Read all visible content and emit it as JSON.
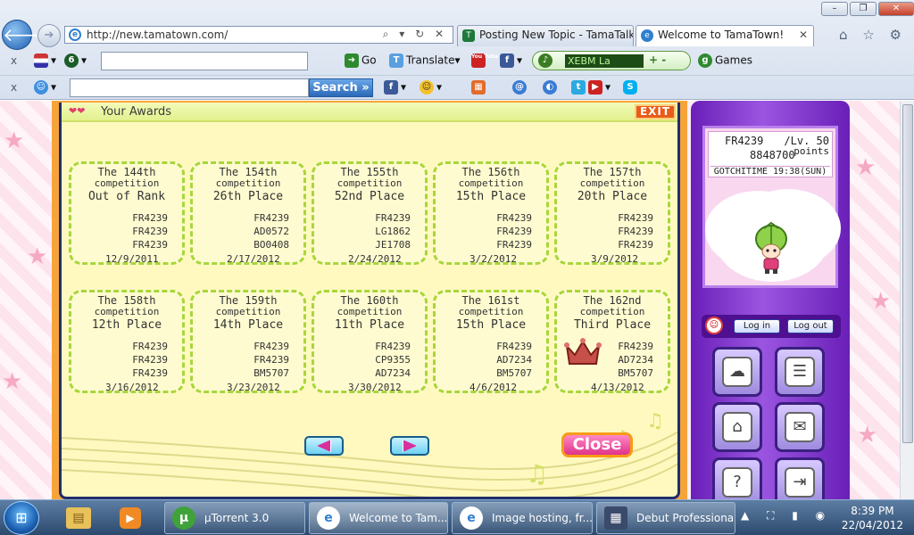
{
  "browser": {
    "window_buttons": {
      "minimize": "–",
      "maximize": "❐",
      "close": "✕"
    },
    "back_glyph": "🡐",
    "forward_glyph": "➔",
    "url": "http://new.tamatown.com/",
    "addr_tools": "⌕ ▾ ↻ ✕",
    "tabs": [
      {
        "label": "Posting New Topic - TamaTalk",
        "active": false
      },
      {
        "label": "Welcome to TamaTown!",
        "active": true
      }
    ],
    "tab_close": "✕",
    "right_tools": "⌂ ☆ ⚙",
    "toolbar1": {
      "close": "x",
      "go": "Go",
      "translate": "Translate",
      "radio_station": "XEBM La",
      "radio_controls": "+ -",
      "games": "Games",
      "tube_badge": "You Tube",
      "fb_badge": "f"
    },
    "toolbar2": {
      "close": "x",
      "search_button": "Search »",
      "fb_badge": "f",
      "skype_badge": "S"
    }
  },
  "awards": {
    "title": "Your Awards",
    "exit": "EXIT",
    "close": "Close",
    "cards": [
      {
        "comp1": "The 144th",
        "comp2": "competition",
        "place": "Out of Rank",
        "names": [
          "FR4239",
          "FR4239",
          "FR4239"
        ],
        "date": "12/9/2011",
        "crown": false
      },
      {
        "comp1": "The 154th",
        "comp2": "competition",
        "place": "26th Place",
        "names": [
          "FR4239",
          "AD0572",
          "BO0408"
        ],
        "date": "2/17/2012",
        "crown": false
      },
      {
        "comp1": "The 155th",
        "comp2": "competition",
        "place": "52nd Place",
        "names": [
          "FR4239",
          "LG1862",
          "JE1708"
        ],
        "date": "2/24/2012",
        "crown": false
      },
      {
        "comp1": "The 156th",
        "comp2": "competition",
        "place": "15th Place",
        "names": [
          "FR4239",
          "FR4239",
          "FR4239"
        ],
        "date": "3/2/2012",
        "crown": false
      },
      {
        "comp1": "The 157th",
        "comp2": "competition",
        "place": "20th Place",
        "names": [
          "FR4239",
          "FR4239",
          "FR4239"
        ],
        "date": "3/9/2012",
        "crown": false
      },
      {
        "comp1": "The 158th",
        "comp2": "competition",
        "place": "12th Place",
        "names": [
          "FR4239",
          "FR4239",
          "FR4239"
        ],
        "date": "3/16/2012",
        "crown": false
      },
      {
        "comp1": "The 159th",
        "comp2": "competition",
        "place": "14th Place",
        "names": [
          "FR4239",
          "FR4239",
          "BM5707"
        ],
        "date": "3/23/2012",
        "crown": false
      },
      {
        "comp1": "The 160th",
        "comp2": "competition",
        "place": "11th Place",
        "names": [
          "FR4239",
          "CP9355",
          "AD7234"
        ],
        "date": "3/30/2012",
        "crown": false
      },
      {
        "comp1": "The 161st",
        "comp2": "competition",
        "place": "15th Place",
        "names": [
          "FR4239",
          "AD7234",
          "BM5707"
        ],
        "date": "4/6/2012",
        "crown": false
      },
      {
        "comp1": "The 162nd",
        "comp2": "competition",
        "place": "Third Place",
        "names": [
          "FR4239",
          "AD7234",
          "BM5707"
        ],
        "date": "4/13/2012",
        "crown": true
      }
    ]
  },
  "tamagotchi": {
    "user_id": "FR4239",
    "level": "/Lv.  50",
    "points": "8848700",
    "points_unit": "points",
    "gotchitime": "GOTCHITIME 19:38(SUN)",
    "login": "Log in",
    "logout": "Log out",
    "avatar_glyph": "☺",
    "menu_glyphs": [
      "☁",
      "☰",
      "⌂",
      "✉",
      "?",
      "⇥"
    ]
  },
  "taskbar": {
    "start_glyph": "⊞",
    "pinned_folder_glyph": "▤",
    "pinned_media_glyph": "▶",
    "apps": [
      {
        "label": "µTorrent 3.0",
        "icon": "µ"
      },
      {
        "label": "Welcome to Tam...",
        "icon": "e"
      },
      {
        "label": "Image hosting, fr...",
        "icon": "e"
      },
      {
        "label": "Debut Professional",
        "icon": "▦"
      }
    ],
    "tray_icons": "▲ ⛶ ▮ ◉",
    "time": "8:39 PM",
    "date": "22/04/2012"
  }
}
